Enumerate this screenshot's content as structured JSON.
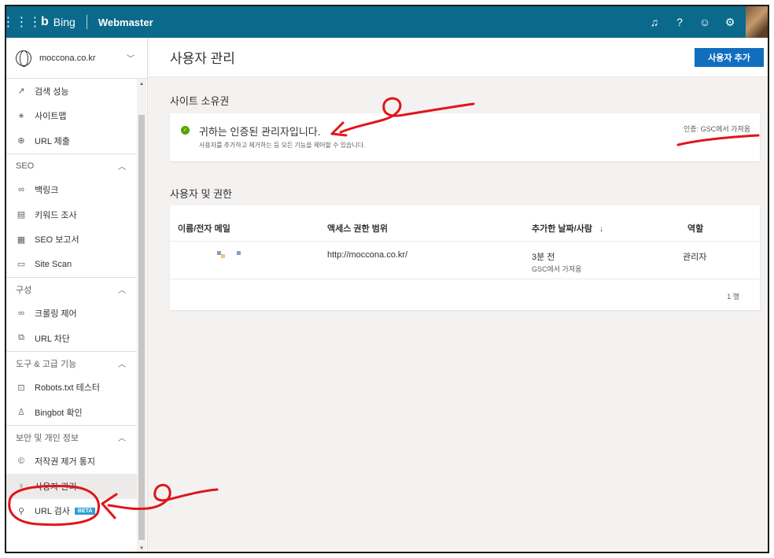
{
  "topbar": {
    "app_name": "Bing",
    "product": "Webmaster",
    "icons": [
      "bell-icon",
      "help-icon",
      "smiley-icon",
      "gear-icon",
      "avatar"
    ]
  },
  "site": {
    "name": "moccona.co.kr"
  },
  "sidebar": {
    "items_top": [
      {
        "icon": "chart-icon",
        "label": "검색 성능"
      },
      {
        "icon": "sitemap-icon",
        "label": "사이트맵"
      },
      {
        "icon": "globe-icon",
        "label": "URL 제출"
      }
    ],
    "seo": {
      "label": "SEO",
      "items": [
        {
          "icon": "link-icon",
          "label": "백링크"
        },
        {
          "icon": "document-icon",
          "label": "키워드 조사"
        },
        {
          "icon": "report-icon",
          "label": "SEO 보고서"
        },
        {
          "icon": "scan-icon",
          "label": "Site Scan"
        }
      ]
    },
    "config": {
      "label": "구성",
      "items": [
        {
          "icon": "link-icon",
          "label": "크롤링 제어"
        },
        {
          "icon": "block-icon",
          "label": "URL 차단"
        }
      ]
    },
    "tools": {
      "label": "도구 & 고급 기능",
      "items": [
        {
          "icon": "robots-icon",
          "label": "Robots.txt 테스터"
        },
        {
          "icon": "bot-icon",
          "label": "Bingbot 확인"
        }
      ]
    },
    "security": {
      "label": "보안 및 개인 정보",
      "items": [
        {
          "icon": "copyright-icon",
          "label": "저작권 제거 통지"
        },
        {
          "icon": "users-icon",
          "label": "사용자 관리"
        },
        {
          "icon": "search-icon",
          "label": "URL 검사",
          "badge": "BETA"
        }
      ]
    }
  },
  "main": {
    "title": "사용자 관리",
    "add_button": "사용자 추가",
    "ownership": {
      "section_title": "사이트 소유권",
      "title": "귀하는 인증된 관리자입니다.",
      "subtitle": "사용자를 추가하고 제거하는 등 모든 기능을 제어할 수 있습니다.",
      "verified_by": "인증: GSC에서 가져옴"
    },
    "users": {
      "section_title": "사용자 및 권한",
      "columns": [
        "이름/전자 메일",
        "액세스 권한 범위",
        "추가한 날짜/사람",
        "역할"
      ],
      "sort_indicator": "↓",
      "rows": [
        {
          "scope": "http://moccona.co.kr/",
          "added": "3분 전",
          "added_by": "GSC에서 가져옴",
          "role": "관리자"
        }
      ],
      "row_count": "1 행"
    }
  },
  "colors": {
    "topbar": "#0b6a8c",
    "accent": "#106ebe",
    "annotation": "#e0151b"
  }
}
